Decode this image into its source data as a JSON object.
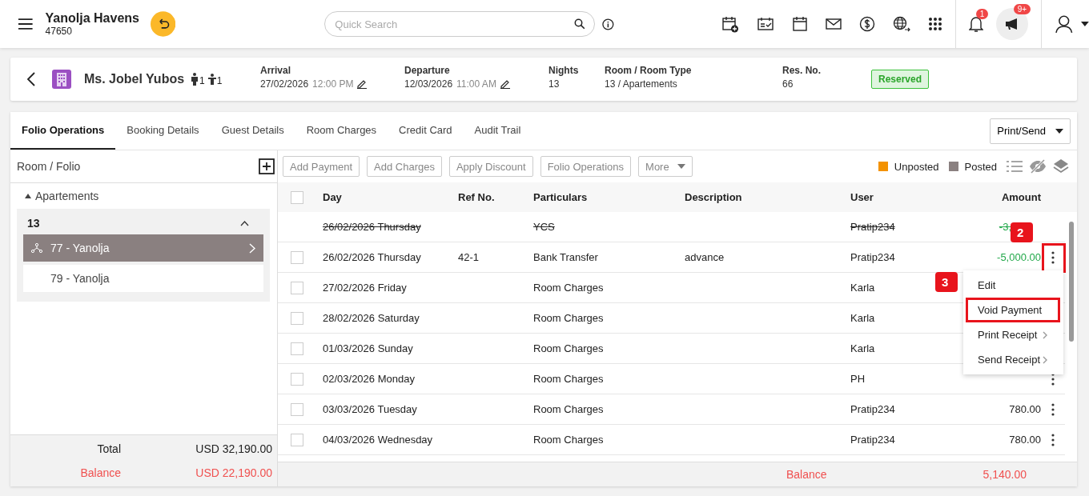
{
  "header": {
    "hotel": "Yanolja Havens",
    "code": "47650",
    "search_placeholder": "Quick Search",
    "notification_count": "1",
    "announcement_count": "9+"
  },
  "reservation": {
    "guest": "Ms. Jobel Yubos",
    "adults": "1",
    "children": "1",
    "status": "Reserved",
    "fields": [
      {
        "label": "Arrival",
        "value": "27/02/2026",
        "time": "12:00 PM",
        "editable": true
      },
      {
        "label": "Departure",
        "value": "12/03/2026",
        "time": "11:00 AM",
        "editable": true
      },
      {
        "label": "Nights",
        "value": "13"
      },
      {
        "label": "Room / Room Type",
        "value": "13 / Apartements"
      },
      {
        "label": "Res. No.",
        "value": "66"
      }
    ]
  },
  "tabs": [
    {
      "label": "Folio Operations",
      "selected": true
    },
    {
      "label": "Booking Details",
      "selected": false
    },
    {
      "label": "Guest Details",
      "selected": false
    },
    {
      "label": "Room Charges",
      "selected": false
    },
    {
      "label": "Credit Card",
      "selected": false
    },
    {
      "label": "Audit Trail",
      "selected": false
    }
  ],
  "print_send": "Print/Send",
  "folio_panel": {
    "title": "Room / Folio",
    "group": "Apartements",
    "expanded": true,
    "room": "13",
    "folios": [
      {
        "label": "77 - Yanolja",
        "selected": true
      },
      {
        "label": "79 - Yanolja",
        "selected": false
      }
    ],
    "total_label": "Total",
    "total": "USD 32,190.00",
    "balance_label": "Balance",
    "balance": "USD 22,190.00"
  },
  "toolbar": [
    "Add Payment",
    "Add Charges",
    "Apply Discount",
    "Folio Operations",
    "More"
  ],
  "legend": [
    {
      "label": "Unposted",
      "color": "#f39200"
    },
    {
      "label": "Posted",
      "color": "#8a8080"
    }
  ],
  "table": {
    "columns": [
      "Day",
      "Ref No.",
      "Particulars",
      "Description",
      "User",
      "Amount"
    ],
    "all_checked": false,
    "rows": [
      {
        "day": "26/02/2026 Thursday",
        "particulars": "YCS",
        "user": "Pratip234",
        "amount": "-3,",
        "voided": true,
        "credit": true,
        "has_menu": false,
        "highlighted": false
      },
      {
        "day": "26/02/2026 Thursday",
        "ref": "42-1",
        "particulars": "Bank Transfer",
        "description": "advance",
        "user": "Pratip234",
        "amount": "-5,000.00",
        "voided": false,
        "checked": false,
        "credit": true,
        "has_menu": true,
        "highlighted": true
      },
      {
        "day": "27/02/2026 Friday",
        "particulars": "Room Charges",
        "user": "Karla",
        "voided": false,
        "checked": false
      },
      {
        "day": "28/02/2026 Saturday",
        "particulars": "Room Charges",
        "user": "Karla",
        "voided": false,
        "checked": false
      },
      {
        "day": "01/03/2026 Sunday",
        "particulars": "Room Charges",
        "user": "Karla",
        "voided": false,
        "checked": false
      },
      {
        "day": "02/03/2026 Monday",
        "particulars": "Room Charges",
        "user": "PH",
        "voided": false,
        "checked": false,
        "has_menu": true,
        "highlighted": false
      },
      {
        "day": "03/03/2026 Tuesday",
        "particulars": "Room Charges",
        "user": "Pratip234",
        "amount": "780.00",
        "voided": false,
        "checked": false,
        "credit": false,
        "has_menu": true,
        "highlighted": false
      },
      {
        "day": "04/03/2026 Wednesday",
        "particulars": "Room Charges",
        "user": "Pratip234",
        "amount": "780.00",
        "voided": false,
        "checked": false,
        "credit": false,
        "has_menu": true,
        "highlighted": false
      }
    ],
    "balance_label": "Balance",
    "balance": "5,140.00"
  },
  "context_menu": [
    {
      "label": "Edit",
      "submenu": false,
      "highlighted": false
    },
    {
      "label": "Void Payment",
      "submenu": false,
      "highlighted": true
    },
    {
      "label": "Print Receipt",
      "submenu": true,
      "highlighted": false
    },
    {
      "label": "Send Receipt",
      "submenu": true,
      "highlighted": false
    }
  ],
  "annotations": [
    {
      "label": "2"
    },
    {
      "label": "3"
    }
  ]
}
